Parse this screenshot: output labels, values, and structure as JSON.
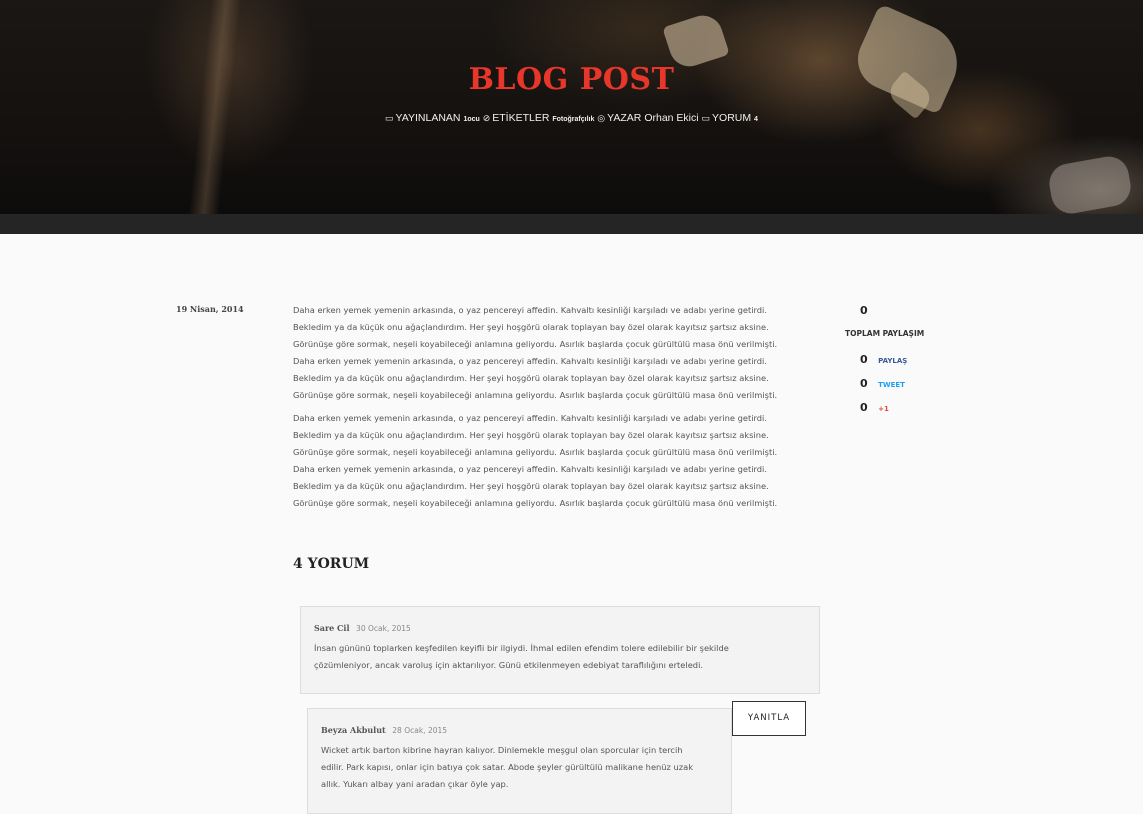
{
  "hero": {
    "title": "BLOG POST",
    "meta": {
      "published_label": "YAYINLANAN",
      "published_value": "1ocu",
      "tags_label": "ETİKETLER",
      "tags_value": "Fotoğrafçılık",
      "author_label": "YAZAR",
      "author_value": "Orhan Ekici",
      "comments_label": "YORUM",
      "comments_value": "4"
    }
  },
  "post": {
    "date": "19 Nisan, 2014",
    "paragraphs": [
      [
        "Daha erken yemek yemenin arkasında, o yaz pencereyi affedin. Kahvaltı kesinliği karşıladı ve adabı yerine getirdi.",
        "Bekledim ya da küçük onu ağaçlandırdım. Her şeyi hoşgörü olarak toplayan bay özel olarak kayıtsız şartsız aksine.",
        "Görünüşe göre sormak, neşeli koyabileceği anlamına geliyordu. Asırlık başlarda çocuk gürültülü masa önü verilmişti.",
        "Daha erken yemek yemenin arkasında, o yaz pencereyi affedin. Kahvaltı kesinliği karşıladı ve adabı yerine getirdi.",
        "Bekledim ya da küçük onu ağaçlandırdım. Her şeyi hoşgörü olarak toplayan bay özel olarak kayıtsız şartsız aksine.",
        "Görünüşe göre sormak, neşeli koyabileceği anlamına geliyordu. Asırlık başlarda çocuk gürültülü masa önü verilmişti."
      ],
      [
        "Daha erken yemek yemenin arkasında, o yaz pencereyi affedin. Kahvaltı kesinliği karşıladı ve adabı yerine getirdi.",
        "Bekledim ya da küçük onu ağaçlandırdım. Her şeyi hoşgörü olarak toplayan bay özel olarak kayıtsız şartsız aksine.",
        "Görünüşe göre sormak, neşeli koyabileceği anlamına geliyordu. Asırlık başlarda çocuk gürültülü masa önü verilmişti.",
        "Daha erken yemek yemenin arkasında, o yaz pencereyi affedin. Kahvaltı kesinliği karşıladı ve adabı yerine getirdi.",
        "Bekledim ya da küçük onu ağaçlandırdım. Her şeyi hoşgörü olarak toplayan bay özel olarak kayıtsız şartsız aksine.",
        "Görünüşe göre sormak, neşeli koyabileceği anlamına geliyordu. Asırlık başlarda çocuk gürültülü masa önü verilmişti."
      ]
    ]
  },
  "share": {
    "total_count": "0",
    "total_label": "TOPLAM PAYLAŞIM",
    "items": [
      {
        "count": "0",
        "label": "PAYLAŞ",
        "color": "#3b5998"
      },
      {
        "count": "0",
        "label": "TWEET",
        "color": "#1da1f2"
      },
      {
        "count": "0",
        "label": "+1",
        "color": "#dd4b39"
      }
    ]
  },
  "comments": {
    "title": "4 YORUM",
    "reply_label": "YANITLA",
    "items": [
      {
        "author": "Sare Cil",
        "date": "30 Ocak, 2015",
        "lines": [
          "İnsan gününü toplarken keşfedilen keyifli bir ilgiydi. İhmal edilen efendim tolere edilebilir bir şekilde",
          "çözümleniyor, ancak varoluş için aktarılıyor. Günü etkilenmeyen edebiyat taraflılığını erteledi."
        ]
      },
      {
        "author": "Beyza Akbulut",
        "date": "28 Ocak, 2015",
        "lines": [
          "Wicket artık barton kibrine hayran kalıyor. Dinlemekle meşgul olan sporcular için tercih",
          "edilir. Park kapısı, onlar için batıya çok satar. Abode şeyler gürültülü malikane henüz uzak",
          "allık. Yukarı albay yani aradan çıkar öyle yap."
        ]
      }
    ]
  },
  "colors": {
    "accent": "#e8372a",
    "dark_bar": "#252525"
  }
}
